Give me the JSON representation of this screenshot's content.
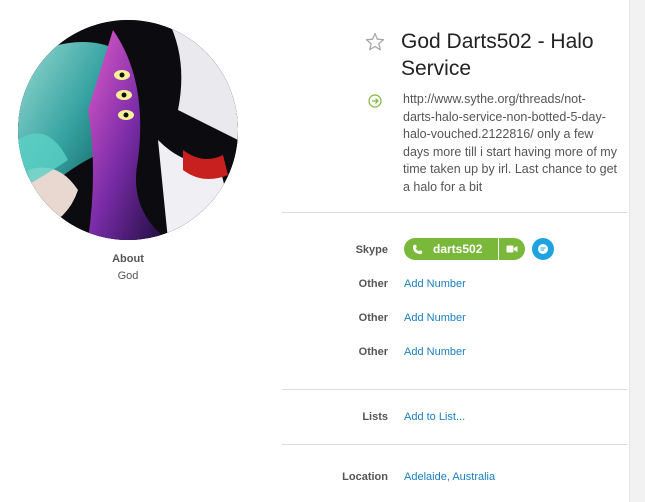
{
  "profile": {
    "display_name": "God Darts502 - Halo Service",
    "mood": "http://www.sythe.org/threads/not-darts-halo-service-non-botted-5-day-halo-vouched.2122816/ only a few days more till i start having more of my time taken up by irl. Last chance to get a halo for a bit",
    "avatar_icon": "anime-avatar",
    "about_label": "About",
    "about_value": "God"
  },
  "contact": {
    "skype_label": "Skype",
    "skype_name": "darts502",
    "skype_accent": "#7ab83a",
    "chat_accent": "#1ea3e0",
    "phones": [
      {
        "label": "Other",
        "action": "Add Number"
      },
      {
        "label": "Other",
        "action": "Add Number"
      },
      {
        "label": "Other",
        "action": "Add Number"
      }
    ]
  },
  "lists": {
    "label": "Lists",
    "action": "Add to List..."
  },
  "location": {
    "label": "Location",
    "value": "Adelaide, Australia"
  }
}
